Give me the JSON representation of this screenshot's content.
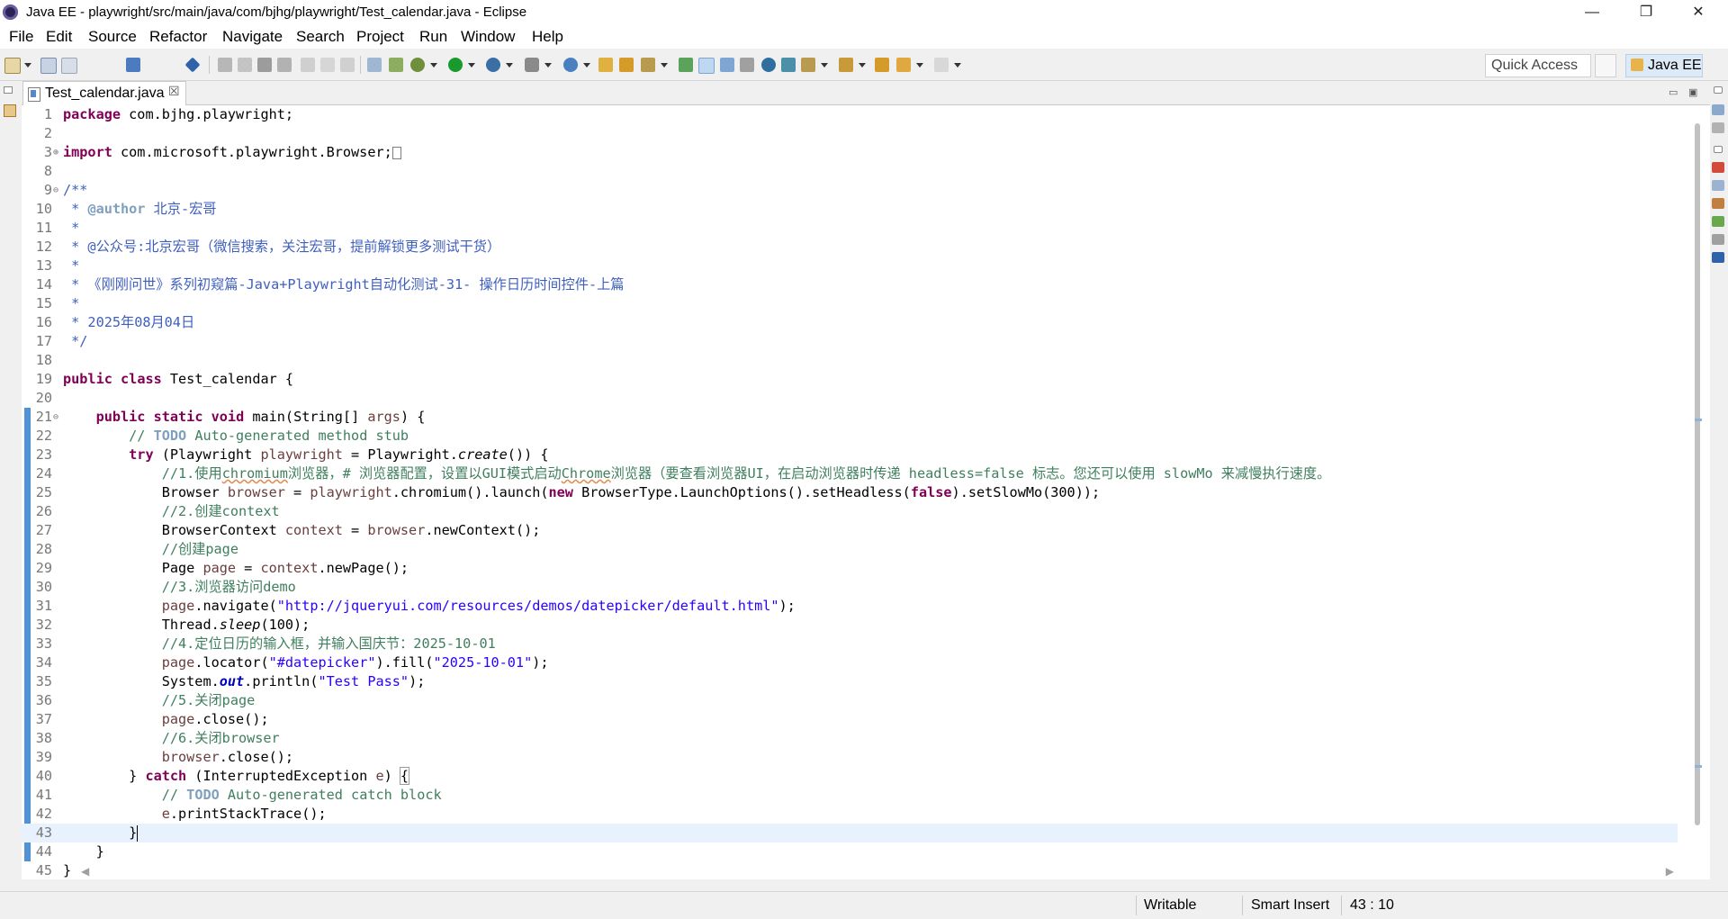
{
  "window": {
    "title": "Java EE - playwright/src/main/java/com/bjhg/playwright/Test_calendar.java - Eclipse",
    "controls": {
      "minimize": "—",
      "maximize": "❐",
      "close": "✕"
    }
  },
  "menu": [
    "File",
    "Edit",
    "Source",
    "Refactor",
    "Navigate",
    "Search",
    "Project",
    "Run",
    "Window",
    "Help"
  ],
  "toolbar": {
    "quick_access": "Quick Access",
    "perspective": "Java EE",
    "colors": {
      "accent": "#dce9f7",
      "run_green": "#1a9a2c",
      "debug": "#3a6ea5"
    }
  },
  "editor": {
    "tab_label": "Test_calendar.java",
    "tab_close": "☒",
    "view_min": "▭",
    "view_max": "▣",
    "lines": [
      {
        "n": "1",
        "html": "<span class=\"kw\">package</span> com.bjhg.playwright;"
      },
      {
        "n": "2",
        "html": ""
      },
      {
        "n": "3",
        "fold": "⊕",
        "html": "<span class=\"kw\">import</span> com.microsoft.playwright.Browser;<span class=\"boxmark\"></span>"
      },
      {
        "n": "8",
        "html": ""
      },
      {
        "n": "9",
        "fold": "⊖",
        "html": "<span class=\"jd\">/**</span>"
      },
      {
        "n": "10",
        "html": "<span class=\"jd\"> * </span><span class=\"tag\">@author</span><span class=\"jd\"> 北京-宏哥</span>"
      },
      {
        "n": "11",
        "html": "<span class=\"jd\"> *</span>"
      },
      {
        "n": "12",
        "html": "<span class=\"jd\"> * @公众号:北京宏哥（微信搜索，关注宏哥，提前解锁更多测试干货）</span>"
      },
      {
        "n": "13",
        "html": "<span class=\"jd\"> *</span>"
      },
      {
        "n": "14",
        "html": "<span class=\"jd\"> * 《刚刚问世》系列初窥篇-Java+Playwright自动化测试-31- 操作日历时间控件-上篇</span>"
      },
      {
        "n": "15",
        "html": "<span class=\"jd\"> *</span>"
      },
      {
        "n": "16",
        "html": "<span class=\"jd\"> * 2025年08月04日</span>"
      },
      {
        "n": "17",
        "html": "<span class=\"jd\"> */</span>"
      },
      {
        "n": "18",
        "html": ""
      },
      {
        "n": "19",
        "html": "<span class=\"kw\">public</span> <span class=\"kw\">class</span> Test_calendar {"
      },
      {
        "n": "20",
        "html": ""
      },
      {
        "n": "21",
        "fold": "⊖",
        "html": "    <span class=\"kw\">public</span> <span class=\"kw\">static</span> <span class=\"kw\">void</span> main(String[] <span class=\"var\">args</span>) {"
      },
      {
        "n": "22",
        "html": "        <span class=\"cm\">// </span><span class=\"todo\">TODO</span><span class=\"cm\"> Auto-generated method stub</span>"
      },
      {
        "n": "23",
        "html": "        <span class=\"kw\">try</span> (Playwright <span class=\"var\">playwright</span> = Playwright.<span class=\"ital\">create</span>()) {"
      },
      {
        "n": "24",
        "html": "            <span class=\"cm\">//1.使用<span class=\"squig\">chromium</span>浏览器，# 浏览器配置，设置以GUI模式启动<span class=\"squig\">Chrome</span>浏览器（要查看浏览器UI，在启动浏览器时传递 headless=false 标志。您还可以使用 slowMo 来减慢执行速度。</span>"
      },
      {
        "n": "25",
        "html": "            Browser <span class=\"var\">browser</span> = <span class=\"var\">playwright</span>.chromium().launch(<span class=\"kw\">new</span> BrowserType.LaunchOptions().setHeadless(<span class=\"kw\">false</span>).setSlowMo(300));"
      },
      {
        "n": "26",
        "html": "            <span class=\"cm\">//2.创建context</span>"
      },
      {
        "n": "27",
        "html": "            BrowserContext <span class=\"var\">context</span> = <span class=\"var\">browser</span>.newContext();"
      },
      {
        "n": "28",
        "html": "            <span class=\"cm\">//创建page</span>"
      },
      {
        "n": "29",
        "html": "            Page <span class=\"var\">page</span> = <span class=\"var\">context</span>.newPage();"
      },
      {
        "n": "30",
        "html": "            <span class=\"cm\">//3.浏览器访问demo</span>"
      },
      {
        "n": "31",
        "html": "            <span class=\"var\">page</span>.navigate(<span class=\"str\">\"http://jqueryui.com/resources/demos/datepicker/default.html\"</span>);"
      },
      {
        "n": "32",
        "html": "            Thread.<span class=\"ital\">sleep</span>(100);"
      },
      {
        "n": "33",
        "html": "            <span class=\"cm\">//4.定位日历的输入框，并输入国庆节：2025-10-01</span>"
      },
      {
        "n": "34",
        "html": "            <span class=\"var\">page</span>.locator(<span class=\"str\">\"#datepicker\"</span>).fill(<span class=\"str\">\"2025-10-01\"</span>);"
      },
      {
        "n": "35",
        "html": "            System.<span class=\"fld ital\">out</span>.println(<span class=\"str\">\"Test Pass\"</span>);"
      },
      {
        "n": "36",
        "html": "            <span class=\"cm\">//5.关闭page</span>"
      },
      {
        "n": "37",
        "html": "            <span class=\"var\">page</span>.close();"
      },
      {
        "n": "38",
        "html": "            <span class=\"cm\">//6.关闭browser</span>"
      },
      {
        "n": "39",
        "html": "            <span class=\"var\">browser</span>.close();"
      },
      {
        "n": "40",
        "html": "        } <span class=\"kw\">catch</span> (InterruptedException <span class=\"var\">e</span>) <span class=\"brace-hl\">{</span>"
      },
      {
        "n": "41",
        "html": "            <span class=\"cm\">// </span><span class=\"todo\">TODO</span><span class=\"cm\"> Auto-generated catch block</span>"
      },
      {
        "n": "42",
        "html": "            <span class=\"var\">e</span>.printStackTrace();"
      },
      {
        "n": "43",
        "cur": true,
        "html": "        }<span class=\"caret\"></span>"
      },
      {
        "n": "44",
        "html": "    }"
      },
      {
        "n": "45",
        "html": "}"
      }
    ]
  },
  "status": {
    "writable": "Writable",
    "insert_mode": "Smart Insert",
    "position": "43 : 10"
  }
}
